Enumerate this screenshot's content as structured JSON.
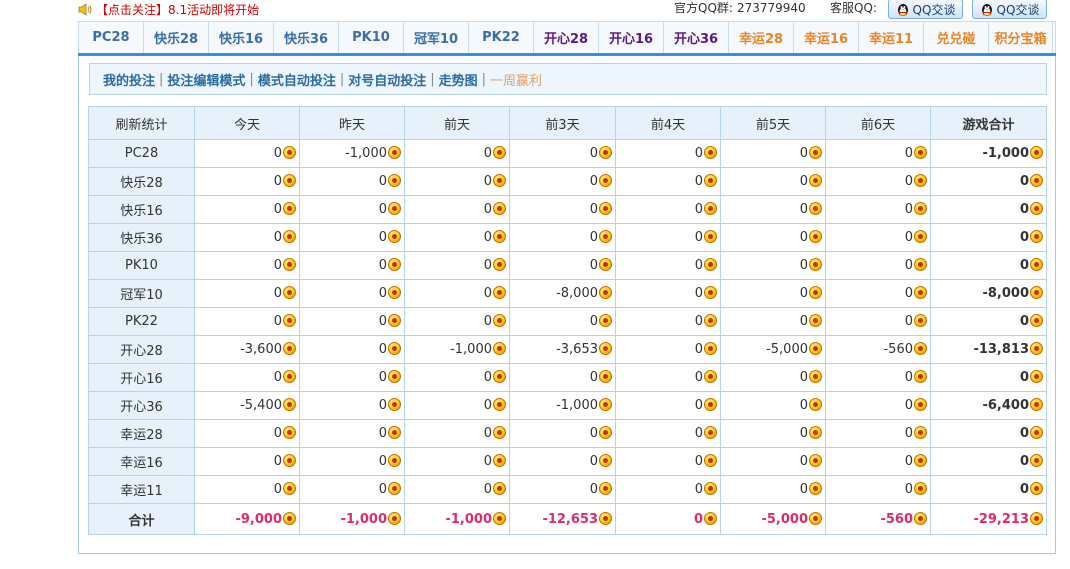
{
  "notice": {
    "open_bracket": "【",
    "follow": "点击关注",
    "close_bracket": "】",
    "text": "8.1活动即将开始"
  },
  "header": {
    "qq_group_label": "官方QQ群:",
    "qq_group_number": "273779940",
    "service_label": "客服QQ:",
    "qq_chat_1": "QQ交谈",
    "qq_chat_2": "QQ交谈"
  },
  "tabs": [
    {
      "label": "PC28",
      "color": "blue"
    },
    {
      "label": "快乐28",
      "color": "blue"
    },
    {
      "label": "快乐16",
      "color": "blue"
    },
    {
      "label": "快乐36",
      "color": "blue"
    },
    {
      "label": "PK10",
      "color": "blue"
    },
    {
      "label": "冠军10",
      "color": "blue"
    },
    {
      "label": "PK22",
      "color": "blue"
    },
    {
      "label": "开心28",
      "color": "purple"
    },
    {
      "label": "开心16",
      "color": "purple"
    },
    {
      "label": "开心36",
      "color": "purple"
    },
    {
      "label": "幸运28",
      "color": "orange"
    },
    {
      "label": "幸运16",
      "color": "orange"
    },
    {
      "label": "幸运11",
      "color": "orange"
    },
    {
      "label": "兑兑碰",
      "color": "orange"
    },
    {
      "label": "积分宝箱",
      "color": "orange"
    }
  ],
  "subnav": {
    "items": [
      "我的投注",
      "投注编辑模式",
      "模式自动投注",
      "对号自动投注",
      "走势图",
      "一周赢利"
    ],
    "separator": "|"
  },
  "table": {
    "headers": [
      "刷新统计",
      "今天",
      "昨天",
      "前天",
      "前3天",
      "前4天",
      "前5天",
      "前6天",
      "游戏合计"
    ],
    "rows": [
      {
        "name": "PC28",
        "values": [
          "0",
          "-1,000",
          "0",
          "0",
          "0",
          "0",
          "0",
          "-1,000"
        ]
      },
      {
        "name": "快乐28",
        "values": [
          "0",
          "0",
          "0",
          "0",
          "0",
          "0",
          "0",
          "0"
        ]
      },
      {
        "name": "快乐16",
        "values": [
          "0",
          "0",
          "0",
          "0",
          "0",
          "0",
          "0",
          "0"
        ]
      },
      {
        "name": "快乐36",
        "values": [
          "0",
          "0",
          "0",
          "0",
          "0",
          "0",
          "0",
          "0"
        ]
      },
      {
        "name": "PK10",
        "values": [
          "0",
          "0",
          "0",
          "0",
          "0",
          "0",
          "0",
          "0"
        ]
      },
      {
        "name": "冠军10",
        "values": [
          "0",
          "0",
          "0",
          "-8,000",
          "0",
          "0",
          "0",
          "-8,000"
        ]
      },
      {
        "name": "PK22",
        "values": [
          "0",
          "0",
          "0",
          "0",
          "0",
          "0",
          "0",
          "0"
        ]
      },
      {
        "name": "开心28",
        "values": [
          "-3,600",
          "0",
          "-1,000",
          "-3,653",
          "0",
          "-5,000",
          "-560",
          "-13,813"
        ]
      },
      {
        "name": "开心16",
        "values": [
          "0",
          "0",
          "0",
          "0",
          "0",
          "0",
          "0",
          "0"
        ]
      },
      {
        "name": "开心36",
        "values": [
          "-5,400",
          "0",
          "0",
          "-1,000",
          "0",
          "0",
          "0",
          "-6,400"
        ]
      },
      {
        "name": "幸运28",
        "values": [
          "0",
          "0",
          "0",
          "0",
          "0",
          "0",
          "0",
          "0"
        ]
      },
      {
        "name": "幸运16",
        "values": [
          "0",
          "0",
          "0",
          "0",
          "0",
          "0",
          "0",
          "0"
        ]
      },
      {
        "name": "幸运11",
        "values": [
          "0",
          "0",
          "0",
          "0",
          "0",
          "0",
          "0",
          "0"
        ]
      }
    ],
    "total": {
      "name": "合计",
      "values": [
        "-9,000",
        "-1,000",
        "-1,000",
        "-12,653",
        "0",
        "-5,000",
        "-560",
        "-29,213"
      ]
    }
  },
  "colors": {
    "tab_blue": "#3a6ea5",
    "tab_purple": "#5a1a86",
    "tab_orange": "#e98527",
    "accent_line": "#3b8fd9",
    "total_red": "#e02a6a",
    "notice_red": "#d40000"
  },
  "icons": {
    "notice": "speaker-icon",
    "qq": "qq-penguin-icon",
    "coin": "coin-icon"
  }
}
